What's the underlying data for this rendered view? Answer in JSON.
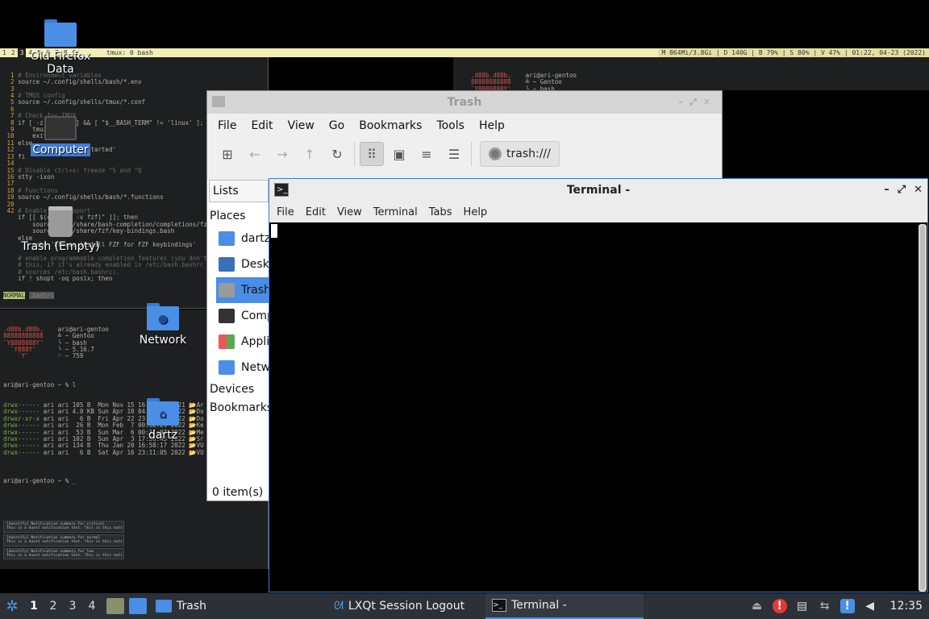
{
  "tmux": {
    "windows": [
      "1",
      "2",
      "3",
      "4",
      "5",
      "6",
      "7",
      "8",
      "9"
    ],
    "active_window": "3",
    "session": "tmux: 0 bash",
    "status_right": "M 864Mi/3.8Gi | D 140G | B 79% | S 80% | V 47% | 01:22, 04-23 (2022)"
  },
  "editor_pane": {
    "lines": [
      {
        "n": "1",
        "t": "# Environment variables"
      },
      {
        "n": "2",
        "t": "source ~/.config/shells/bash/*.env"
      },
      {
        "n": "3",
        "t": ""
      },
      {
        "n": "4",
        "t": "# TMUX config"
      },
      {
        "n": "5",
        "t": "source ~/.config/shells/tmux/*.conf"
      },
      {
        "n": "6",
        "t": ""
      },
      {
        "n": "7",
        "t": "# Check for TMUX"
      },
      {
        "n": "8",
        "t": "if [ -z \"$TMUX\" ] && [ \"$__BASH_TERM\" != 'linux' ]; then"
      },
      {
        "n": "9",
        "t": "    tmux"
      },
      {
        "n": "10",
        "t": "    exit"
      },
      {
        "n": "11",
        "t": "else"
      },
      {
        "n": "12",
        "t": "    echo 'TMUX not started'"
      },
      {
        "n": "13",
        "t": "fi"
      },
      {
        "n": "14",
        "t": ""
      },
      {
        "n": "15",
        "t": "# Disable ctrl+s: freeze ^S and ^Q"
      },
      {
        "n": "16",
        "t": "stty -ixon"
      },
      {
        "n": "17",
        "t": ""
      },
      {
        "n": "18",
        "t": "# Functions"
      },
      {
        "n": "19",
        "t": "source ~/.config/shells/bash/*.functions"
      },
      {
        "n": "20",
        "t": ""
      },
      {
        "n": "42",
        "t": "# Enable FZF support"
      },
      {
        "n": "",
        "t": "if [[ $(command -v fzf)\" ]]; then"
      },
      {
        "n": "",
        "t": "    source /usr/share/bash-completion/completions/fzf"
      },
      {
        "n": "",
        "t": "    source /usr/share/fzf/key-bindings.bash"
      },
      {
        "n": "",
        "t": "else"
      },
      {
        "n": "",
        "t": "    echo 'Please install FZF for FZF keybindings'"
      },
      {
        "n": "",
        "t": ""
      },
      {
        "n": "",
        "t": "# enable programmable completion features (you don't need to enable"
      },
      {
        "n": "",
        "t": "# this, if it's already enabled in /etc/bash.bashrc and /etc/profile"
      },
      {
        "n": "",
        "t": "# sources /etc/bash.bashrc)."
      },
      {
        "n": "",
        "t": "if ! shopt -oq posix; then"
      }
    ],
    "mode": "NORMAL",
    "file": ".bashrc"
  },
  "shell_pane": {
    "fetch_art": [
      ".d88b.d88b,",
      "88888888888",
      "`Y8888888Y'",
      "  `Y888Y'",
      "    `Y'"
    ],
    "fetch_info": [
      "ari@ari-gentoo",
      "╧ ~ Gentoo",
      "╰ ~ bash",
      "╰ ~ 5.16.7",
      "♡ ~ 759"
    ],
    "prompt1": "ari@ari-gentoo ~ % l",
    "listing": [
      "drwx------ ari ari 105 B  Mon Nov 15 16:59:38 2021 📂Ar",
      "drwx------ ari ari 4.0 KB Sun Apr 10 04:11:00 2022 📂Do",
      "drwxr-xr-x ari ari   6 B  Fri Apr 22 23:07:33 2022 📂Do",
      "drwx------ ari ari  26 B  Mon Feb  7 00:32:29 2022 📂Ke",
      "drwx------ ari ari  53 B  Sun Mar  6 00:11:07 2022 📂Me",
      "drwx------ ari ari 102 B  Sun Apr  3 17:56:45 2022 📂Sr",
      "drwx------ ari ari 134 B  Thu Jan 20 16:58:17 2022 📂VU",
      "drwx------ ari ari   6 B  Sat Apr 16 23:11:05 2022 📂VU"
    ],
    "prompt2": "ari@ari-gentoo ~ % _"
  },
  "right_pane": {
    "fetch_art": [
      ".d88b.d88b,",
      "88888888888",
      "`Y8888888Y'",
      "  `Y888Y'"
    ],
    "fetch_info": [
      "ari@ari-gentoo",
      "╧ ~ Gentoo",
      "╰ ~ bash",
      "♡ ~ 5.16.7"
    ]
  },
  "notifications": [
    {
      "head": "[dunstify] Notification summary for critical",
      "body": "This is a dunst notification test. This is this notification's body :)"
    },
    {
      "head": "[dunstify] Notification summary for normal",
      "body": "This is a dunst notification test. This is this notification's body :)"
    },
    {
      "head": "[dunstify] Notification summary for low",
      "body": "This is a dunst notification test. This is this notification's body :)"
    }
  ],
  "desktop": {
    "icons": [
      {
        "label": "Old Firefox Data"
      },
      {
        "label": "Computer"
      },
      {
        "label": "Trash (Empty)"
      },
      {
        "label": "Network"
      },
      {
        "label": "dartz"
      }
    ]
  },
  "trash_window": {
    "title": "Trash",
    "menu": [
      "File",
      "Edit",
      "View",
      "Go",
      "Bookmarks",
      "Tools",
      "Help"
    ],
    "path": "trash:///",
    "side_combo": "Lists",
    "places_header": "Places",
    "places": [
      "dartz",
      "Desktop",
      "Trash",
      "Computer",
      "Applications",
      "Network"
    ],
    "devices_header": "Devices",
    "bookmarks_header": "Bookmarks",
    "status": "0 item(s)"
  },
  "terminal_window": {
    "title": "Terminal -",
    "menu": [
      "File",
      "Edit",
      "View",
      "Terminal",
      "Tabs",
      "Help"
    ]
  },
  "taskbar": {
    "desktops": [
      "1",
      "2",
      "3",
      "4"
    ],
    "active_desktop": "1",
    "tasks": [
      {
        "label": "Trash",
        "active": false
      },
      {
        "label": "LXQt Session Logout",
        "active": false
      },
      {
        "label": "Terminal -",
        "active": true
      }
    ],
    "clock": "12:35"
  },
  "colors": {
    "accent": "#3d7bd6",
    "folder_blue": "#4a8ee6",
    "taskbar_bg": "#2c3037",
    "tmux_status_bg": "#f2eeb8",
    "alert_red": "#e53935"
  }
}
